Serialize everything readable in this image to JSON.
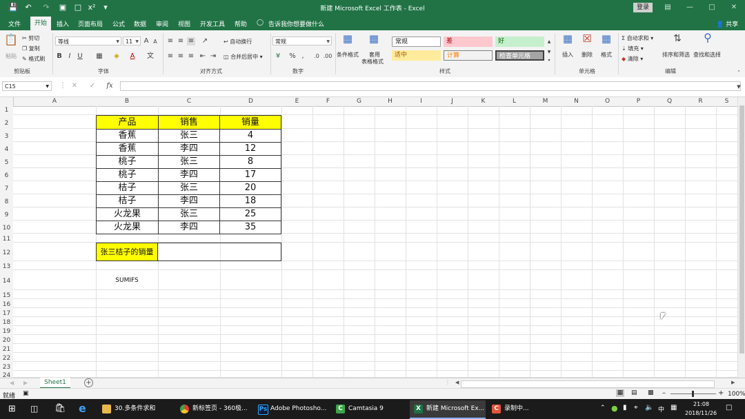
{
  "window": {
    "title": "新建 Microsoft Excel 工作表 - Excel",
    "login_label": "登录",
    "share_label": "共享"
  },
  "tabs": [
    "文件",
    "开始",
    "插入",
    "页面布局",
    "公式",
    "数据",
    "审阅",
    "视图",
    "开发工具",
    "帮助"
  ],
  "tell_me": "告诉我你想要做什么",
  "ribbon": {
    "clipboard": {
      "paste": "粘贴",
      "cut": "剪切",
      "copy": "复制",
      "format_painter": "格式刷",
      "label": "剪贴板"
    },
    "font": {
      "name": "等线",
      "size": "11",
      "label": "字体"
    },
    "alignment": {
      "wrap": "自动换行",
      "merge": "合并后居中",
      "label": "对齐方式"
    },
    "number": {
      "format": "常规",
      "label": "数字"
    },
    "styles": {
      "conditional": "条件格式",
      "table": "套用",
      "table2": "表格格式",
      "normal": "常规",
      "bad": "差",
      "good": "好",
      "neutral": "适中",
      "calc": "计算",
      "check": "检查单元格",
      "label": "样式"
    },
    "cells": {
      "insert": "插入",
      "delete": "删除",
      "format": "格式",
      "label": "单元格"
    },
    "editing": {
      "autosum": "自动求和",
      "fill": "填充",
      "clear": "清除",
      "sort": "排序和筛选",
      "find": "查找和选择",
      "label": "编辑"
    }
  },
  "formula_bar": {
    "name_box": "C15",
    "fx": "fx",
    "value": ""
  },
  "columns": [
    "A",
    "B",
    "C",
    "D",
    "E",
    "F",
    "G",
    "H",
    "I",
    "J",
    "K",
    "L",
    "M",
    "N",
    "O",
    "P",
    "Q",
    "R",
    "S"
  ],
  "rows": [
    "1",
    "2",
    "3",
    "4",
    "5",
    "6",
    "7",
    "8",
    "9",
    "10",
    "11",
    "12",
    "13",
    "14",
    "15",
    "16",
    "17",
    "18",
    "19",
    "20",
    "21",
    "22",
    "23",
    "24"
  ],
  "table": {
    "headers": [
      "产品",
      "销售",
      "销量"
    ],
    "rows": [
      [
        "香蕉",
        "张三",
        "4"
      ],
      [
        "香蕉",
        "李四",
        "12"
      ],
      [
        "桃子",
        "张三",
        "8"
      ],
      [
        "桃子",
        "李四",
        "17"
      ],
      [
        "桔子",
        "张三",
        "20"
      ],
      [
        "桔子",
        "李四",
        "18"
      ],
      [
        "火龙果",
        "张三",
        "25"
      ],
      [
        "火龙果",
        "李四",
        "35"
      ]
    ]
  },
  "query": {
    "label": "张三桔子的销量",
    "value": ""
  },
  "note": "SUMIFS",
  "sheet": {
    "tab": "Sheet1",
    "add": "+"
  },
  "status": {
    "ready": "就绪",
    "zoom": "100%"
  },
  "taskbar": {
    "apps": [
      "30.多条件求和",
      "新标签页 - 360极...",
      "Adobe Photosho...",
      "Camtasia 9",
      "新建 Microsoft Ex...",
      "录制中..."
    ],
    "ime": "中",
    "time": "21:08",
    "date": "2018/11/26"
  },
  "colors": {
    "excel_green": "#217346",
    "header_yellow": "#ffff00",
    "bad_bg": "#ffc7ce",
    "good_bg": "#c6efce",
    "neutral_bg": "#ffeb9c"
  }
}
